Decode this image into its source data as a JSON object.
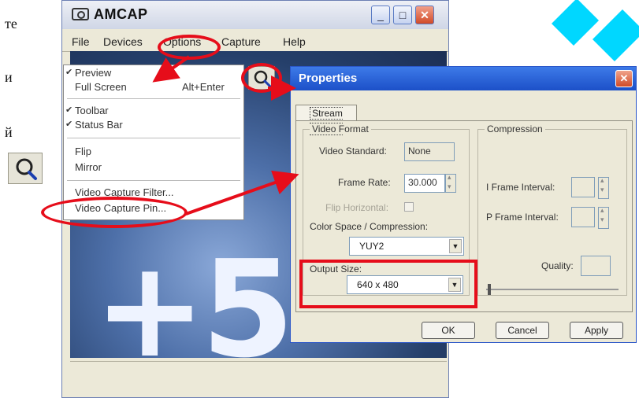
{
  "left_text": [
    "те",
    "и",
    "й"
  ],
  "amcap": {
    "title": "AMCAP",
    "menus": [
      "File",
      "Devices",
      "Options",
      "Capture",
      "Help"
    ],
    "min_icon": "minimize-icon",
    "max_icon": "maximize-icon",
    "close_icon": "close-icon",
    "video_overlay_text": "+5"
  },
  "options_menu": {
    "items": [
      {
        "label": "Preview",
        "checked": true
      },
      {
        "label": "Full Screen",
        "shortcut": "Alt+Enter",
        "checked": false
      },
      {
        "label": "Toolbar",
        "checked": true
      },
      {
        "label": "Status Bar",
        "checked": true
      },
      {
        "label": "Flip",
        "checked": false
      },
      {
        "label": "Mirror",
        "checked": false
      },
      {
        "label": "Video Capture Filter...",
        "checked": false
      },
      {
        "label": "Video Capture Pin...",
        "checked": false
      }
    ]
  },
  "properties": {
    "title": "Properties",
    "tab": "Stream Format",
    "video_format": {
      "group_label": "Video Format",
      "video_standard_label": "Video Standard:",
      "video_standard_value": "None",
      "frame_rate_label": "Frame Rate:",
      "frame_rate_value": "30.000",
      "flip_label": "Flip Horizontal:",
      "color_space_label": "Color Space / Compression:",
      "color_space_value": "YUY2",
      "output_size_label": "Output Size:",
      "output_size_value": "640 x 480"
    },
    "compression": {
      "group_label": "Compression",
      "i_frame_label": "I Frame Interval:",
      "p_frame_label": "P Frame Interval:",
      "quality_label": "Quality:"
    },
    "buttons": {
      "ok": "OK",
      "cancel": "Cancel",
      "apply": "Apply"
    }
  },
  "colors": {
    "annotation_red": "#e60d1a",
    "watermark_cyan": "#00d7ff",
    "dialog_title_blue": "#1c50c8"
  }
}
